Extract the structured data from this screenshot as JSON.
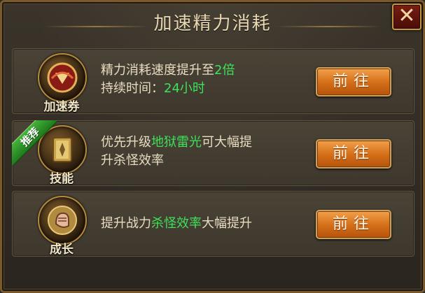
{
  "window": {
    "title": "加速精力消耗",
    "close_symbol": "✕"
  },
  "rows": [
    {
      "icon_label": "加速券",
      "icon_name": "speed-ticket-icon",
      "line1": [
        "精力消耗速度提升至",
        "2倍",
        ""
      ],
      "line2": [
        "持续时间：",
        "24小时",
        ""
      ],
      "button": "前往"
    },
    {
      "badge": "推荐",
      "icon_label": "技能",
      "icon_name": "skill-book-icon",
      "line1": [
        "优先升级",
        "地狱雷光",
        "可大幅提"
      ],
      "line2": [
        "升杀怪效率",
        "",
        ""
      ],
      "button": "前往"
    },
    {
      "icon_label": "成长",
      "icon_name": "fist-icon",
      "line1": [
        "提升战力",
        "杀怪效率",
        "大幅提升"
      ],
      "button": "前往"
    }
  ],
  "colors": {
    "highlight": "#3fe05a",
    "frame": "#7a5a2c",
    "button": "#d36d17"
  }
}
